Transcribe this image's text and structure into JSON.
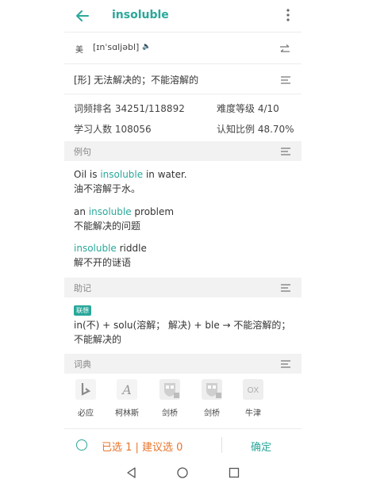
{
  "appbar": {
    "title": "insoluble"
  },
  "pronunciation": {
    "region": "美",
    "ipa": "[ɪnˈsɑljəbl]",
    "speaker": "🔈"
  },
  "definition": {
    "text": "[形] 无法解决的；不能溶解的"
  },
  "stats": {
    "rank": "词频排名 34251/118892",
    "difficulty": "难度等级 4/10",
    "learners": "学习人数 108056",
    "cognition": "认知比例 48.70%"
  },
  "sections": {
    "examples": "例句",
    "memory": "助记",
    "dictionary": "词典"
  },
  "examples": [
    {
      "pre": "Oil is ",
      "word": "insoluble",
      "post": " in water.",
      "zh": "油不溶解于水。"
    },
    {
      "pre": "an ",
      "word": "insoluble",
      "post": " problem",
      "zh": "不能解决的问题"
    },
    {
      "pre": "",
      "word": "insoluble",
      "post": " riddle",
      "zh": "解不开的谜语"
    }
  ],
  "memory": {
    "tag": "联想",
    "line1": "in(不) + solu(溶解； 解决) + ble → 不能溶解的；",
    "line2": "不能解决的"
  },
  "dictionaries": [
    {
      "name": "必应",
      "icon": "bing-icon"
    },
    {
      "name": "柯林斯",
      "icon": "collins-icon"
    },
    {
      "name": "剑桥",
      "icon": "cambridge-icon"
    },
    {
      "name": "剑桥",
      "icon": "cambridge-icon"
    },
    {
      "name": "牛津",
      "icon": "oxford-icon"
    }
  ],
  "bottom": {
    "selected": "已选 1 | 建议选 0",
    "confirm": "确定"
  },
  "colors": {
    "accent": "#2aa89a",
    "orange": "#e8742b",
    "section_bg": "#f2f2f2"
  }
}
